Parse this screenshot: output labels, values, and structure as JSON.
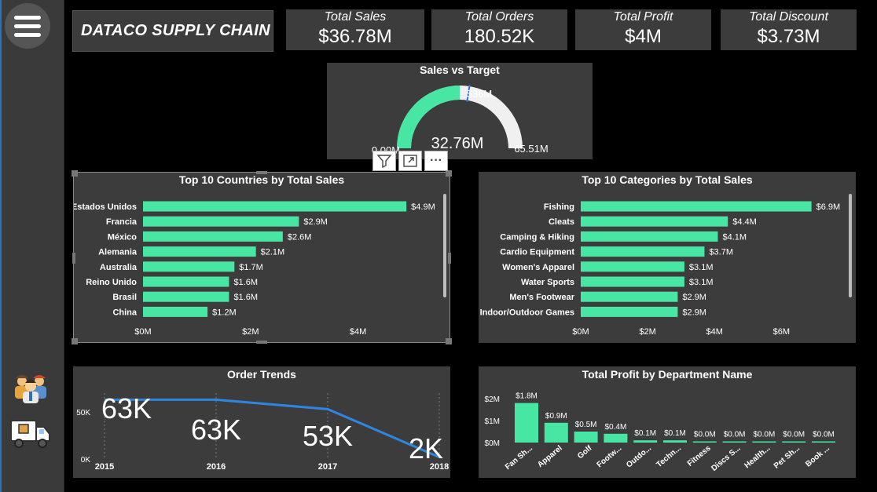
{
  "brand": {
    "title": "DATACO SUPPLY CHAIN"
  },
  "kpis": [
    {
      "title": "Total Sales",
      "value": "$36.78M"
    },
    {
      "title": "Total Orders",
      "value": "180.52K"
    },
    {
      "title": "Total Profit",
      "value": "$4M"
    },
    {
      "title": "Total Discount",
      "value": "$3.73M"
    }
  ],
  "sidebar": {
    "menu_icon": "hamburger-menu-icon",
    "icons": [
      "team-people-icon",
      "delivery-truck-icon"
    ]
  },
  "gauge": {
    "title": "Sales vs Target",
    "min_label": "0.00M",
    "max_label": "65.51M",
    "target_label": "$36M",
    "value_label": "32.76M",
    "min": 0,
    "max": 65.51,
    "value": 32.76,
    "target": 36,
    "colors": {
      "fill": "#47e6a2",
      "track": "#f0f0f0",
      "target": "#2f6fe0"
    }
  },
  "toolbar": {
    "icons": [
      "filter-icon",
      "focus-mode-icon",
      "more-options-icon"
    ],
    "more_label": "···"
  },
  "chart_data": [
    {
      "type": "bar",
      "orientation": "horizontal",
      "title": "Top 10 Countries by Total Sales",
      "categories": [
        "Estados Unidos",
        "Francia",
        "México",
        "Alemania",
        "Australia",
        "Reino Unido",
        "Brasil",
        "China"
      ],
      "values": [
        4.9,
        2.9,
        2.6,
        2.1,
        1.7,
        1.6,
        1.6,
        1.2
      ],
      "data_labels": [
        "$4.9M",
        "$2.9M",
        "$2.6M",
        "$2.1M",
        "$1.7M",
        "$1.6M",
        "$1.6M",
        "$1.2M"
      ],
      "xticks": [
        "$0M",
        "$2M",
        "$4M"
      ],
      "xtick_values": [
        0,
        2,
        4
      ],
      "xlim": [
        0,
        5.0
      ],
      "color": "#47e6a2"
    },
    {
      "type": "bar",
      "orientation": "horizontal",
      "title": "Top 10 Categories by Total Sales",
      "categories": [
        "Fishing",
        "Cleats",
        "Camping & Hiking",
        "Cardio Equipment",
        "Women's Apparel",
        "Water Sports",
        "Men's Footwear",
        "Indoor/Outdoor Games"
      ],
      "values": [
        6.9,
        4.4,
        4.1,
        3.7,
        3.1,
        3.1,
        2.9,
        2.9
      ],
      "data_labels": [
        "$6.9M",
        "$4.4M",
        "$4.1M",
        "$3.7M",
        "$3.1M",
        "$3.1M",
        "$2.9M",
        "$2.9M"
      ],
      "xticks": [
        "$0M",
        "$2M",
        "$4M",
        "$6M"
      ],
      "xtick_values": [
        0,
        2,
        4,
        6
      ],
      "xlim": [
        0,
        7.05
      ],
      "color": "#47e6a2"
    },
    {
      "type": "line",
      "title": "Order Trends",
      "x": [
        "2015",
        "2016",
        "2017",
        "2018"
      ],
      "values": [
        63,
        63,
        53,
        2
      ],
      "data_labels": [
        "63K",
        "63K",
        "53K",
        "2K"
      ],
      "yticks": [
        "0K",
        "50K"
      ],
      "ytick_values": [
        0,
        50
      ],
      "ylim": [
        0,
        75
      ],
      "color": "#2f86e0"
    },
    {
      "type": "bar",
      "orientation": "vertical",
      "title": "Total Profit by Department Name",
      "categories": [
        "Fan Sh...",
        "Apparel",
        "Golf",
        "Footw...",
        "Outdo...",
        "Techn...",
        "Fitness",
        "Discs S...",
        "Health...",
        "Pet Sh...",
        "Book ..."
      ],
      "values": [
        1.8,
        0.9,
        0.5,
        0.4,
        0.1,
        0.1,
        0.0,
        0.0,
        0.0,
        0.0,
        0.0
      ],
      "data_labels": [
        "$1.8M",
        "$0.9M",
        "$0.5M",
        "$0.4M",
        "$0.1M",
        "$0.1M",
        "$0.0M",
        "$0.0M",
        "$0.0M",
        "$0.0M",
        "$0.0M"
      ],
      "yticks": [
        "$0M",
        "$1M",
        "$2M"
      ],
      "ytick_values": [
        0,
        1,
        2
      ],
      "ylim": [
        0,
        2
      ],
      "color": "#47e6a2"
    }
  ]
}
